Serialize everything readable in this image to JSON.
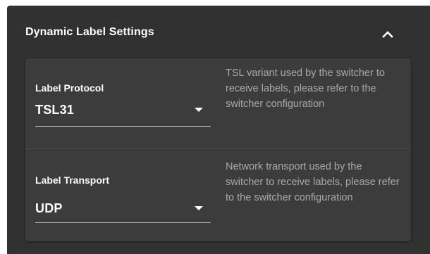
{
  "panel": {
    "title": "Dynamic Label Settings",
    "collapse_icon": "chevron-up-icon"
  },
  "settings": [
    {
      "label": "Label Protocol",
      "value": "TSL31",
      "help": "TSL variant used by the switcher to receive labels, please refer to the switcher configuration"
    },
    {
      "label": "Label Transport",
      "value": "UDP",
      "help": "Network transport used by the switcher to receive labels, please refer to the switcher configuration"
    }
  ],
  "colors": {
    "panel_bg": "#313131",
    "card_bg": "#3c3c3c",
    "text_primary": "#ffffff",
    "text_secondary": "#a9a9a9"
  }
}
